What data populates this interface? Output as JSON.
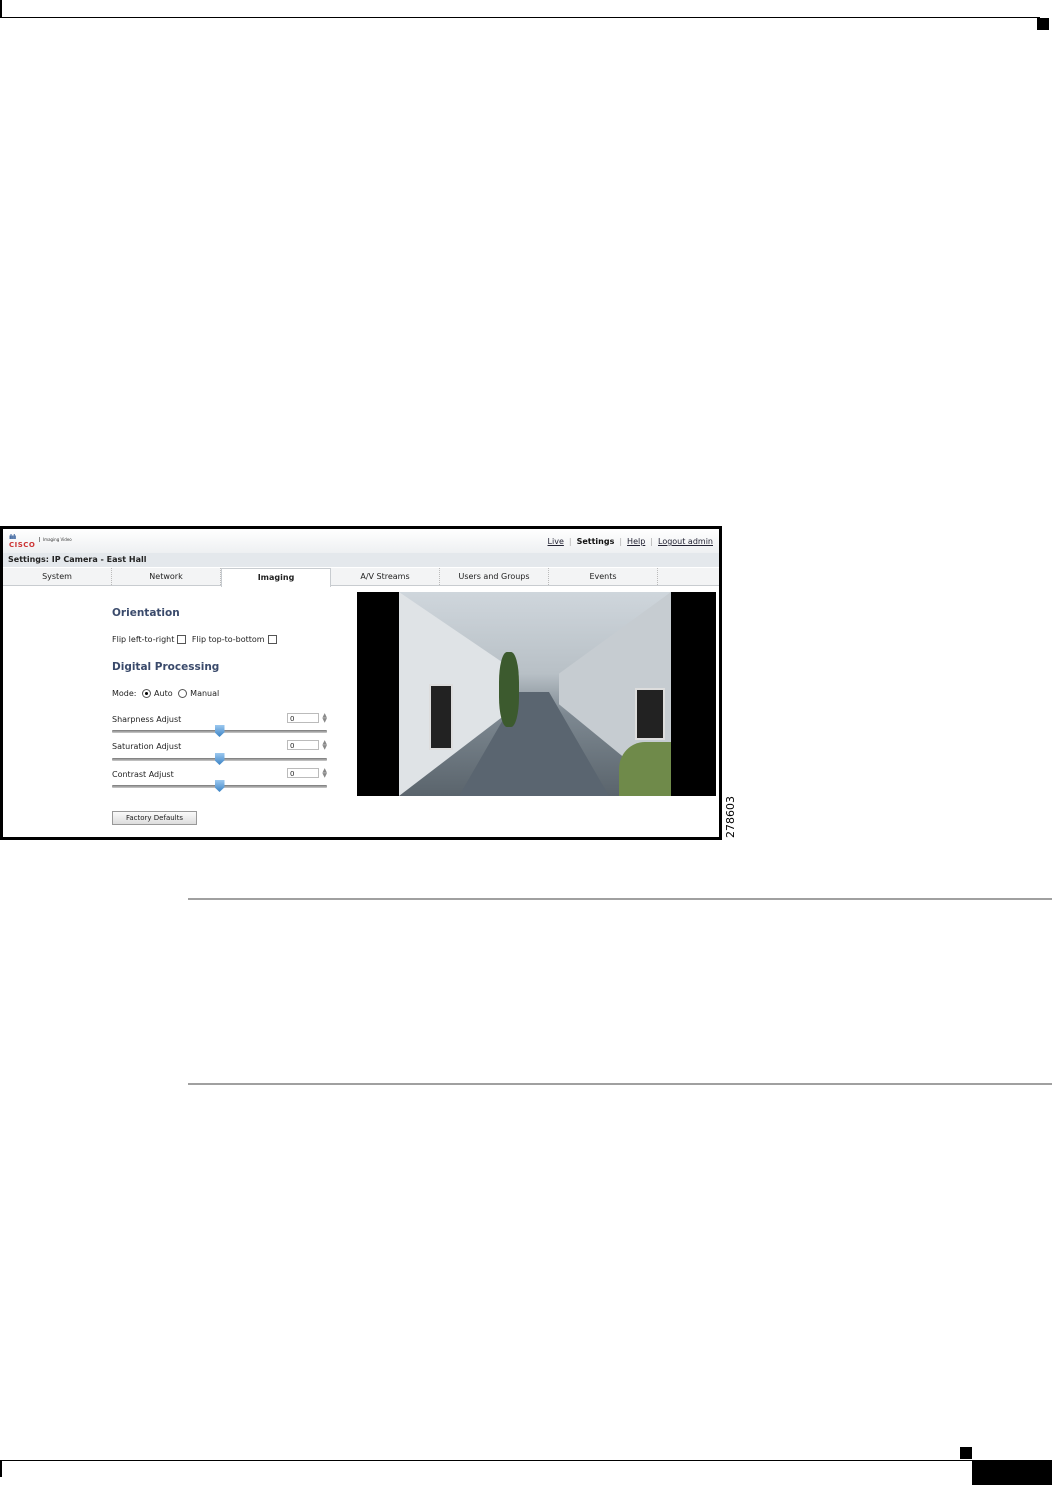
{
  "app": {
    "logo": {
      "brand": "CISCO",
      "product": "Imaging Video"
    },
    "nav": {
      "live": "Live",
      "settings": "Settings",
      "help": "Help",
      "logout": "Logout admin"
    },
    "page_title": "Settings: IP Camera - East Hall",
    "tabs": [
      {
        "label": "System",
        "active": false
      },
      {
        "label": "Network",
        "active": false
      },
      {
        "label": "Imaging",
        "active": true
      },
      {
        "label": "A/V Streams",
        "active": false
      },
      {
        "label": "Users and Groups",
        "active": false
      },
      {
        "label": "Events",
        "active": false
      }
    ],
    "orientation": {
      "heading": "Orientation",
      "flip_lr": "Flip left-to-right",
      "flip_tb": "Flip top-to-bottom",
      "flip_lr_checked": false,
      "flip_tb_checked": false
    },
    "digital": {
      "heading": "Digital Processing",
      "mode_label": "Mode:",
      "auto": "Auto",
      "manual": "Manual",
      "selected_mode": "Auto",
      "sliders": [
        {
          "label": "Sharpness Adjust",
          "value": "0",
          "position_pct": 50
        },
        {
          "label": "Saturation Adjust",
          "value": "0",
          "position_pct": 50
        },
        {
          "label": "Contrast Adjust",
          "value": "0",
          "position_pct": 50
        }
      ]
    },
    "factory_defaults": "Factory Defaults"
  },
  "figure_number": "278603"
}
